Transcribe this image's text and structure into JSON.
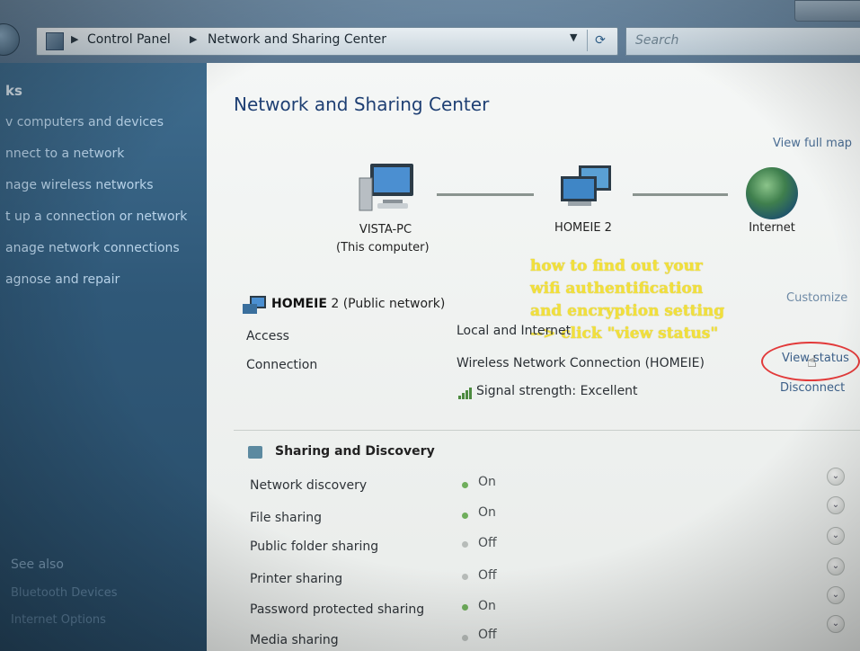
{
  "address_bar": {
    "crumbs": [
      "Control Panel",
      "Network and Sharing Center"
    ],
    "search_placeholder": "Search"
  },
  "sidebar": {
    "heading": "ks",
    "tasks": [
      "v computers and devices",
      "nnect to a network",
      "nage wireless networks",
      "t up a connection or network",
      "anage network connections",
      "agnose and repair"
    ],
    "see_also_heading": "See also",
    "see_also": [
      "Bluetooth Devices",
      "Internet Options"
    ]
  },
  "main": {
    "title": "Network and Sharing Center",
    "view_full_map": "View full map",
    "nodes": {
      "computer_name": "VISTA-PC",
      "computer_sub": "(This computer)",
      "network_name": "HOMEIE 2",
      "internet": "Internet"
    },
    "network": {
      "name": "HOMEIE",
      "suffix": "2 (Public network)",
      "customize": "Customize",
      "access_label": "Access",
      "access_value": "Local and Internet",
      "connection_label": "Connection",
      "connection_value": "Wireless Network Connection (HOMEIE)",
      "signal": "Signal strength:  Excellent",
      "view_status": "View status",
      "disconnect": "Disconnect"
    },
    "annotation": [
      "how to find out your",
      "wifi authentification",
      "and encryption setting",
      "--> click \"view status\""
    ],
    "sharing": {
      "title": "Sharing and Discovery",
      "rows": [
        {
          "label": "Network discovery",
          "status": "On"
        },
        {
          "label": "File sharing",
          "status": "On"
        },
        {
          "label": "Public folder sharing",
          "status": "Off"
        },
        {
          "label": "Printer sharing",
          "status": "Off"
        },
        {
          "label": "Password protected sharing",
          "status": "On"
        },
        {
          "label": "Media sharing",
          "status": "Off"
        }
      ]
    }
  },
  "colors": {
    "on": "#6fae5c",
    "off": "#b7bcb9",
    "annotation": "#f2e03a",
    "circle": "#e23a3a"
  }
}
